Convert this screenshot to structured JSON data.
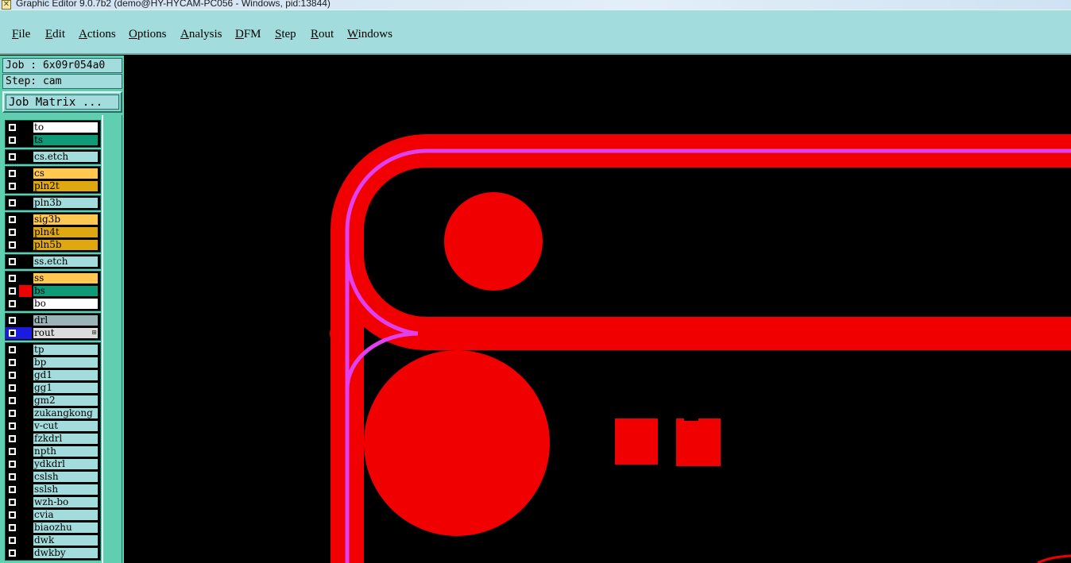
{
  "window": {
    "title": "Graphic Editor 9.0.7b2 (demo@HY-HYCAM-PC056 - Windows, pid:13844)"
  },
  "menu": [
    {
      "label": "File",
      "u": "F",
      "rest": "ile"
    },
    {
      "label": "Edit",
      "u": "E",
      "rest": "dit"
    },
    {
      "label": "Actions",
      "u": "A",
      "rest": "ctions"
    },
    {
      "label": "Options",
      "u": "O",
      "rest": "ptions"
    },
    {
      "label": "Analysis",
      "u": "A",
      "rest": "nalysis"
    },
    {
      "label": "DFM",
      "u": "D",
      "rest": "FM"
    },
    {
      "label": "Step",
      "u": "S",
      "rest": "tep"
    },
    {
      "label": "Rout",
      "u": "R",
      "rest": "out"
    },
    {
      "label": "Windows",
      "u": "W",
      "rest": "indows"
    }
  ],
  "panel": {
    "job": "Job : 6x09r054a0",
    "step": "Step: cam",
    "job_matrix": "Job Matrix ..."
  },
  "colors": {
    "menu_bg": "#a3dcdc",
    "panel_bg": "#5fcfb0",
    "canvas_bg": "#000000",
    "feature_red": "#f00000",
    "rout_magenta": "#e040f0"
  },
  "layers": [
    {
      "name": "to",
      "bg": "#ffffff",
      "swatch": "#000000"
    },
    {
      "name": "ts",
      "bg": "#0f9a78",
      "swatch": "#000000"
    },
    {
      "name": "cs.etch",
      "bg": "#a3dcdc",
      "swatch": "#000000"
    },
    {
      "name": "cs",
      "bg": "#ffc850",
      "swatch": "#000000"
    },
    {
      "name": "pln2t",
      "bg": "#e0a810",
      "swatch": "#000000"
    },
    {
      "name": "pln3b",
      "bg": "#a3dcdc",
      "swatch": "#000000"
    },
    {
      "name": "sig3b",
      "bg": "#ffc850",
      "swatch": "#000000"
    },
    {
      "name": "pln4t",
      "bg": "#e0a810",
      "swatch": "#000000"
    },
    {
      "name": "pln5b",
      "bg": "#e0a810",
      "swatch": "#000000"
    },
    {
      "name": "ss.etch",
      "bg": "#a3dcdc",
      "swatch": "#000000"
    },
    {
      "name": "ss",
      "bg": "#ffc850",
      "swatch": "#000000"
    },
    {
      "name": "bs",
      "bg": "#0f9a78",
      "swatch": "#f00000"
    },
    {
      "name": "bo",
      "bg": "#ffffff",
      "swatch": "#000000"
    },
    {
      "name": "drl",
      "bg": "#9ab4b8",
      "swatch": "#000000"
    },
    {
      "name": "rout",
      "bg": "#dcdcdc",
      "swatch": "#1a1ae0",
      "active": true
    },
    {
      "name": "tp",
      "bg": "#a3dcdc",
      "swatch": "#000000"
    },
    {
      "name": "bp",
      "bg": "#a3dcdc",
      "swatch": "#000000"
    },
    {
      "name": "gd1",
      "bg": "#a3dcdc",
      "swatch": "#000000"
    },
    {
      "name": "gg1",
      "bg": "#a3dcdc",
      "swatch": "#000000"
    },
    {
      "name": "gm2",
      "bg": "#a3dcdc",
      "swatch": "#000000"
    },
    {
      "name": "zukangkong",
      "bg": "#a3dcdc",
      "swatch": "#000000"
    },
    {
      "name": "v-cut",
      "bg": "#a3dcdc",
      "swatch": "#000000"
    },
    {
      "name": "fzkdrl",
      "bg": "#a3dcdc",
      "swatch": "#000000"
    },
    {
      "name": "npth",
      "bg": "#a3dcdc",
      "swatch": "#000000"
    },
    {
      "name": "ydkdrl",
      "bg": "#a3dcdc",
      "swatch": "#000000"
    },
    {
      "name": "cslsh",
      "bg": "#a3dcdc",
      "swatch": "#000000"
    },
    {
      "name": "sslsh",
      "bg": "#a3dcdc",
      "swatch": "#000000"
    },
    {
      "name": "wzh-bo",
      "bg": "#a3dcdc",
      "swatch": "#000000"
    },
    {
      "name": "cvia",
      "bg": "#a3dcdc",
      "swatch": "#000000"
    },
    {
      "name": "biaozhu",
      "bg": "#a3dcdc",
      "swatch": "#000000"
    },
    {
      "name": "dwk",
      "bg": "#a3dcdc",
      "swatch": "#000000"
    },
    {
      "name": "dwkby",
      "bg": "#a3dcdc",
      "swatch": "#000000"
    }
  ]
}
